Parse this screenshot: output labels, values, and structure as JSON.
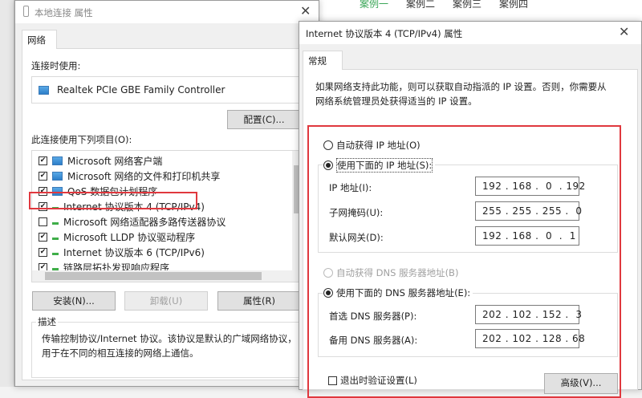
{
  "background": {
    "tabs": [
      "案例一",
      "案例二",
      "案例三",
      "案例四"
    ],
    "active_color": "#3aa657"
  },
  "left_dialog": {
    "title": "本地连接 属性",
    "tab": "网络",
    "connect_using_label": "连接时使用:",
    "adapter": "Realtek PCIe GBE Family Controller",
    "configure_button": "配置(C)...",
    "items_label": "此连接使用下列项目(O):",
    "items": [
      {
        "label": "Microsoft 网络客户端",
        "checked": true,
        "icon": "pc"
      },
      {
        "label": "Microsoft 网络的文件和打印机共享",
        "checked": true,
        "icon": "pc"
      },
      {
        "label": "QoS 数据包计划程序",
        "checked": true,
        "icon": "pc"
      },
      {
        "label": "Internet 协议版本 4 (TCP/IPv4)",
        "checked": true,
        "icon": "net"
      },
      {
        "label": "Microsoft 网络适配器多路传送器协议",
        "checked": false,
        "icon": "net"
      },
      {
        "label": "Microsoft LLDP 协议驱动程序",
        "checked": true,
        "icon": "net"
      },
      {
        "label": "Internet 协议版本 6 (TCP/IPv6)",
        "checked": true,
        "icon": "net"
      },
      {
        "label": "链路层拓扑发现响应程序",
        "checked": true,
        "icon": "net"
      }
    ],
    "install_button": "安装(N)...",
    "uninstall_button": "卸载(U)",
    "properties_button": "属性(R)",
    "description_label": "描述",
    "description": "传输控制协议/Internet 协议。该协议是默认的广域网络协议，用于在不同的相互连接的网络上通信。"
  },
  "right_dialog": {
    "title": "Internet 协议版本 4 (TCP/IPv4) 属性",
    "tab": "常规",
    "intro": "如果网络支持此功能，则可以获取自动指派的 IP 设置。否则，你需要从网络系统管理员处获得适当的 IP 设置。",
    "auto_ip": "自动获得 IP 地址(O)",
    "manual_ip": "使用下面的 IP 地址(S):",
    "ip_label": "IP 地址(I):",
    "ip": "192 . 168 .  0  . 192",
    "mask_label": "子网掩码(U):",
    "mask": "255 . 255 . 255 .  0",
    "gateway_label": "默认网关(D):",
    "gateway": "192 . 168 .  0  .  1",
    "auto_dns": "自动获得 DNS 服务器地址(B)",
    "manual_dns": "使用下面的 DNS 服务器地址(E):",
    "dns1_label": "首选 DNS 服务器(P):",
    "dns1": "202 . 102 . 152 .  3",
    "dns2_label": "备用 DNS 服务器(A):",
    "dns2": "202 . 102 . 128 . 68",
    "validate_label": "退出时验证设置(L)",
    "advanced_button": "高级(V)...",
    "highlight_color": "#e0383e"
  }
}
